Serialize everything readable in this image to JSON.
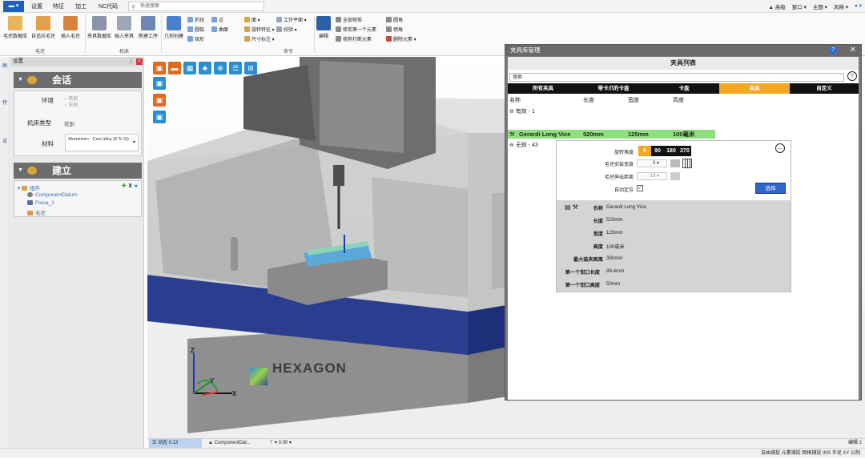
{
  "ribbon": {
    "tabs": [
      "设置",
      "特征",
      "加工",
      "NC代码"
    ],
    "search_placeholder": "快速搜索",
    "right_items": [
      "▲ 高级",
      "窗口 ▾",
      "主题 ▾",
      "风格 ▾"
    ],
    "buttons": {
      "stock_db": "毛坯数据库",
      "auto_stock": "自适应毛坯",
      "insert_stock": "插入毛坯",
      "fixture_db": "夹具数据库",
      "insert_fixture": "插入夹具",
      "new_workpiece": "新建工序",
      "geometry_create": "几何创建",
      "edit": "编辑"
    },
    "small": {
      "polyline": "折线",
      "point": "点",
      "circle": "圆弧",
      "surface": "曲面",
      "rect": "矩形",
      "face": "面",
      "rotate_feature": "旋转特征",
      "size_annotate": "尺寸标注",
      "check": "校验",
      "workplane": "工作平面",
      "trim_all": "全部修剪",
      "trim_first": "修剪第一个元素",
      "trim_break": "修剪打断元素",
      "fillet": "圆角",
      "chamfer": "倒角",
      "delete_elem": "删除元素"
    },
    "groups": [
      "毛坯",
      "机床",
      "命令"
    ]
  },
  "strip": [
    "图",
    "特",
    "设"
  ],
  "left_panel": {
    "title": "设置",
    "session": {
      "header": "会话",
      "env_label": "环境",
      "env_opt1": "铣削",
      "env_opt2": "车削",
      "machine_type_label": "机床类型",
      "machine_type_value": "铣削",
      "material_label": "材料",
      "material_value": "Aluminium - Cast alloy (6 % Si)"
    },
    "build": {
      "header": "建立",
      "tree_root": "组件",
      "tree_items": [
        "ComponentDatum",
        "Fresa_1",
        "毛坯"
      ]
    }
  },
  "viewport": {
    "logo_text": "HEXAGON",
    "axis_x": "X",
    "axis_y": "Y",
    "axis_z": "Z",
    "status": {
      "dynamic": "动态 0.13",
      "component": "ComponentDat...",
      "angle": "0.00"
    },
    "corner": "编辑 2"
  },
  "status_bar": "自由捕捉   元素捕捉   网格捕捉   INS   半径   XY   公制",
  "dialog": {
    "title": "夹具库管理",
    "list_title": "夹具列表",
    "search_placeholder": "搜索",
    "tabs": [
      "所有夹具",
      "带卡爪的卡盘",
      "卡盘",
      "夹具",
      "自定义"
    ],
    "active_tab": 3,
    "columns": [
      "名称",
      "长度",
      "宽度",
      "高度"
    ],
    "group_valid": "有效 - 1",
    "group_invalid": "无效 - 43",
    "selected_row": {
      "name": "Gerardi Long Vice",
      "length": "520mm",
      "width": "125mm",
      "height": "100毫米"
    },
    "detail": {
      "rotation_label": "旋转角度",
      "angles": [
        "0",
        "90",
        "180",
        "270"
      ],
      "selected_angle": 0,
      "stock_mount_label": "毛坯安装宽度",
      "stock_mount_value": "0",
      "stock_overhang_label": "毛坯伸出距离",
      "stock_overhang_value": "19",
      "auto_position_label": "自动定位",
      "select_button": "选择",
      "info": [
        {
          "label": "名称",
          "value": "Gerardi Long Vice"
        },
        {
          "label": "长度",
          "value": "520mm"
        },
        {
          "label": "宽度",
          "value": "125mm"
        },
        {
          "label": "高度",
          "value": "100毫米"
        },
        {
          "label": "最大装夹距离",
          "value": "350mm"
        },
        {
          "label": "第一个钳口长度",
          "value": "89.4mm"
        },
        {
          "label": "第一个钳口高度",
          "value": "50mm"
        }
      ]
    }
  }
}
